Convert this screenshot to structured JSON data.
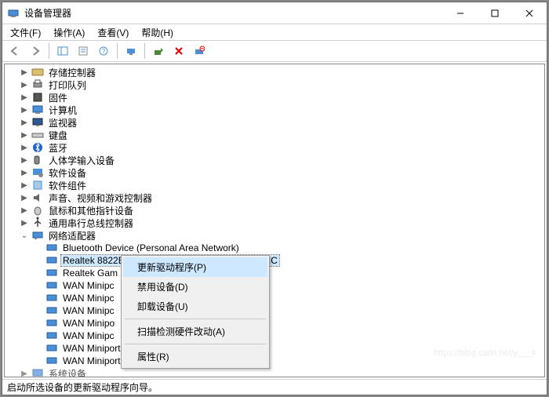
{
  "window": {
    "title": "设备管理器"
  },
  "menu": {
    "file": "文件(F)",
    "action": "操作(A)",
    "view": "查看(V)",
    "help": "帮助(H)"
  },
  "tree": {
    "cat": {
      "storage": "存储控制器",
      "printq": "打印队列",
      "firmware": "固件",
      "computer": "计算机",
      "monitor": "监视器",
      "keyboard": "键盘",
      "bluetooth": "蓝牙",
      "hid": "人体学输入设备",
      "software": "软件设备",
      "softcomp": "软件组件",
      "sound": "声音、视频和游戏控制器",
      "mouse": "鼠标和其他指针设备",
      "usb": "通用串行总线控制器",
      "netadapter": "网络适配器",
      "sysdevices": "系统设备"
    },
    "net": {
      "btpan": "Bluetooth Device (Personal Area Network)",
      "rtk8822": "Realtek 8822BE Wireless LAN 802.11ac PCI-E NIC",
      "rtkgam_trunc": "Realtek Gam",
      "wan_trunc": "WAN Minipo",
      "wan_trunc2": "WAN Minipc",
      "wan_pptp": "WAN Miniport (PPTP)",
      "wan_sstp": "WAN Miniport (SSTP)"
    }
  },
  "ctx": {
    "update": "更新驱动程序(P)",
    "disable": "禁用设备(D)",
    "uninstall": "卸载设备(U)",
    "scan": "扫描检测硬件改动(A)",
    "properties": "属性(R)"
  },
  "status": {
    "text": "启动所选设备的更新驱动程序向导。"
  },
  "watermark": "https://blog.csdn.net/y___k"
}
